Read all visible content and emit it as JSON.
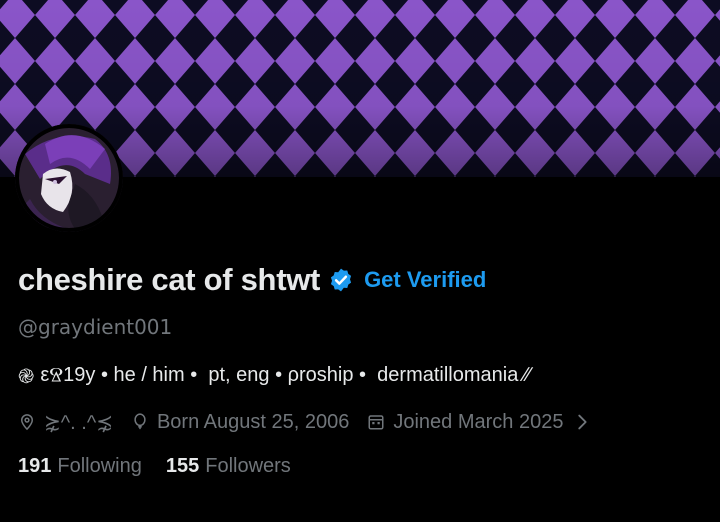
{
  "banner": {
    "pattern": "harlequin-diamonds",
    "colors": [
      "#8a55c9",
      "#0d0c22"
    ]
  },
  "avatar": {
    "description_icon": "avatar-image"
  },
  "profile": {
    "display_name": "cheshire cat of shtwt",
    "get_verified_label": "Get Verified",
    "handle": "@graydient001",
    "verified_color": "#1d9bf0"
  },
  "bio": {
    "spiral": "֎",
    "part1": "εⰔ19у",
    "sep1": " • ",
    "part2": "he / him",
    "sep2": " •  ",
    "part3": "pt, eng",
    "sep3": " • ",
    "part4": "ρroship",
    "sep4": " •  ",
    "part5": "dermatillomania ∕∕"
  },
  "meta": {
    "location": "⋩^. .^⋨",
    "birthday": "Born August 25, 2006",
    "joined": "Joined March 2025"
  },
  "stats": {
    "following_count": "191",
    "following_label": "Following",
    "followers_count": "155",
    "followers_label": "Followers"
  }
}
